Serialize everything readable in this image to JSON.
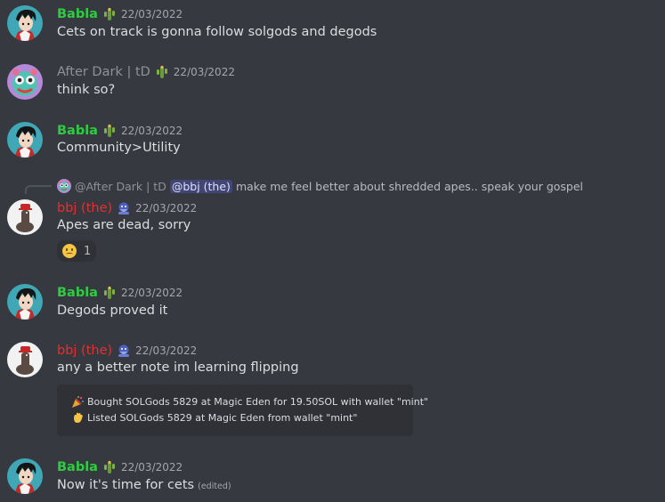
{
  "colors": {
    "background": "#36393f",
    "babla_name": "#2ecc40",
    "bbj_name": "#ed2d2d",
    "afterdark_name": "#8e9297",
    "timestamp": "#a3a6aa",
    "mention_bg": "#414675",
    "embed_bg": "#2f3136"
  },
  "messages": [
    {
      "author": "Babla",
      "badge_icon": "cactus-icon",
      "timestamp": "22/03/2022",
      "text": "Cets on track is gonna follow solgods and degods"
    },
    {
      "author": "After Dark | tD",
      "badge_icon": "cactus-icon",
      "timestamp": "22/03/2022",
      "text": "think so?"
    },
    {
      "author": "Babla",
      "badge_icon": "cactus-icon",
      "timestamp": "22/03/2022",
      "text": "Community>Utility"
    },
    {
      "reply": {
        "author": "@After Dark | tD",
        "mention": "@bbj (the)",
        "text": "make me feel better about shredded apes.. speak your gospel"
      },
      "author": "bbj (the)",
      "badge_icon": "gorilla-icon",
      "timestamp": "22/03/2022",
      "text": "Apes are dead, sorry",
      "reaction": {
        "emoji": "slightly-frowning-face-icon",
        "count": "1"
      }
    },
    {
      "author": "Babla",
      "badge_icon": "cactus-icon",
      "timestamp": "22/03/2022",
      "text": "Degods proved it"
    },
    {
      "author": "bbj (the)",
      "badge_icon": "gorilla-icon",
      "timestamp": "22/03/2022",
      "text": "any a better note im learning flipping",
      "embed": [
        {
          "icon": "party-popper-icon",
          "text": "Bought SOLGods 5829 at Magic Eden for 19.50SOL with wallet \"mint\""
        },
        {
          "icon": "waving-hand-icon",
          "text": "Listed SOLGods 5829 at Magic Eden from wallet \"mint\""
        }
      ]
    },
    {
      "author": "Babla",
      "badge_icon": "cactus-icon",
      "timestamp": "22/03/2022",
      "text": "Now it's time for cets",
      "edited": "(edited)"
    }
  ]
}
